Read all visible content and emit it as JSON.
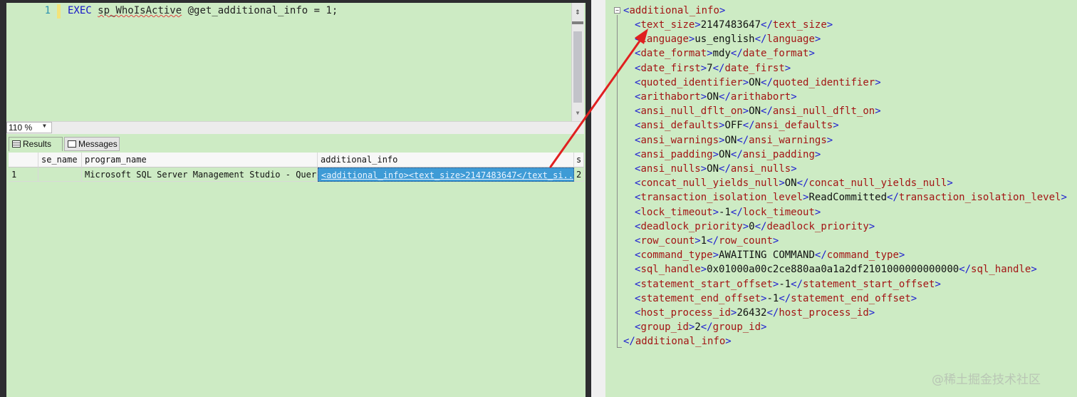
{
  "editor": {
    "line_number": "1",
    "code_exec": "EXEC",
    "code_proc": "sp_WhoIsActive",
    "code_rest": " @get_additional_info = 1;",
    "split_icon": "split-window-icon"
  },
  "zoom": {
    "value": "110 %"
  },
  "tabs": {
    "results_label": "Results",
    "messages_label": "Messages"
  },
  "grid": {
    "columns": [
      "se_name",
      "program_name",
      "additional_info",
      "s"
    ],
    "rows": [
      {
        "row_number": "1",
        "se_name": "",
        "program_name": "Microsoft SQL Server Management Studio - Query",
        "additional_info": "<additional_info><text_size>2147483647</text_si...",
        "s": "2"
      }
    ]
  },
  "xml_viewer": {
    "collapse_symbol": "−",
    "root_open": "additional_info",
    "root_close": "additional_info",
    "elements": [
      {
        "tag": "text_size",
        "value": "2147483647"
      },
      {
        "tag": "language",
        "value": "us_english"
      },
      {
        "tag": "date_format",
        "value": "mdy"
      },
      {
        "tag": "date_first",
        "value": "7"
      },
      {
        "tag": "quoted_identifier",
        "value": "ON"
      },
      {
        "tag": "arithabort",
        "value": "ON"
      },
      {
        "tag": "ansi_null_dflt_on",
        "value": "ON"
      },
      {
        "tag": "ansi_defaults",
        "value": "OFF"
      },
      {
        "tag": "ansi_warnings",
        "value": "ON"
      },
      {
        "tag": "ansi_padding",
        "value": "ON"
      },
      {
        "tag": "ansi_nulls",
        "value": "ON"
      },
      {
        "tag": "concat_null_yields_null",
        "value": "ON"
      },
      {
        "tag": "transaction_isolation_level",
        "value": "ReadCommitted"
      },
      {
        "tag": "lock_timeout",
        "value": "-1"
      },
      {
        "tag": "deadlock_priority",
        "value": "0"
      },
      {
        "tag": "row_count",
        "value": "1"
      },
      {
        "tag": "command_type",
        "value": "AWAITING COMMAND"
      },
      {
        "tag": "sql_handle",
        "value": "0x01000a00c2ce880aa0a1a2df2101000000000000"
      },
      {
        "tag": "statement_start_offset",
        "value": "-1"
      },
      {
        "tag": "statement_end_offset",
        "value": "-1"
      },
      {
        "tag": "host_process_id",
        "value": "26432"
      },
      {
        "tag": "group_id",
        "value": "2"
      }
    ]
  },
  "watermark": "@稀土掘金技术社区",
  "colors": {
    "background": "#cdebc4",
    "keyword": "#1414c8",
    "xml_tag": "#a31515",
    "xml_bracket": "#1b1bd0",
    "annotation_arrow": "#e02020",
    "selected_cell": "#3e9bd6"
  }
}
